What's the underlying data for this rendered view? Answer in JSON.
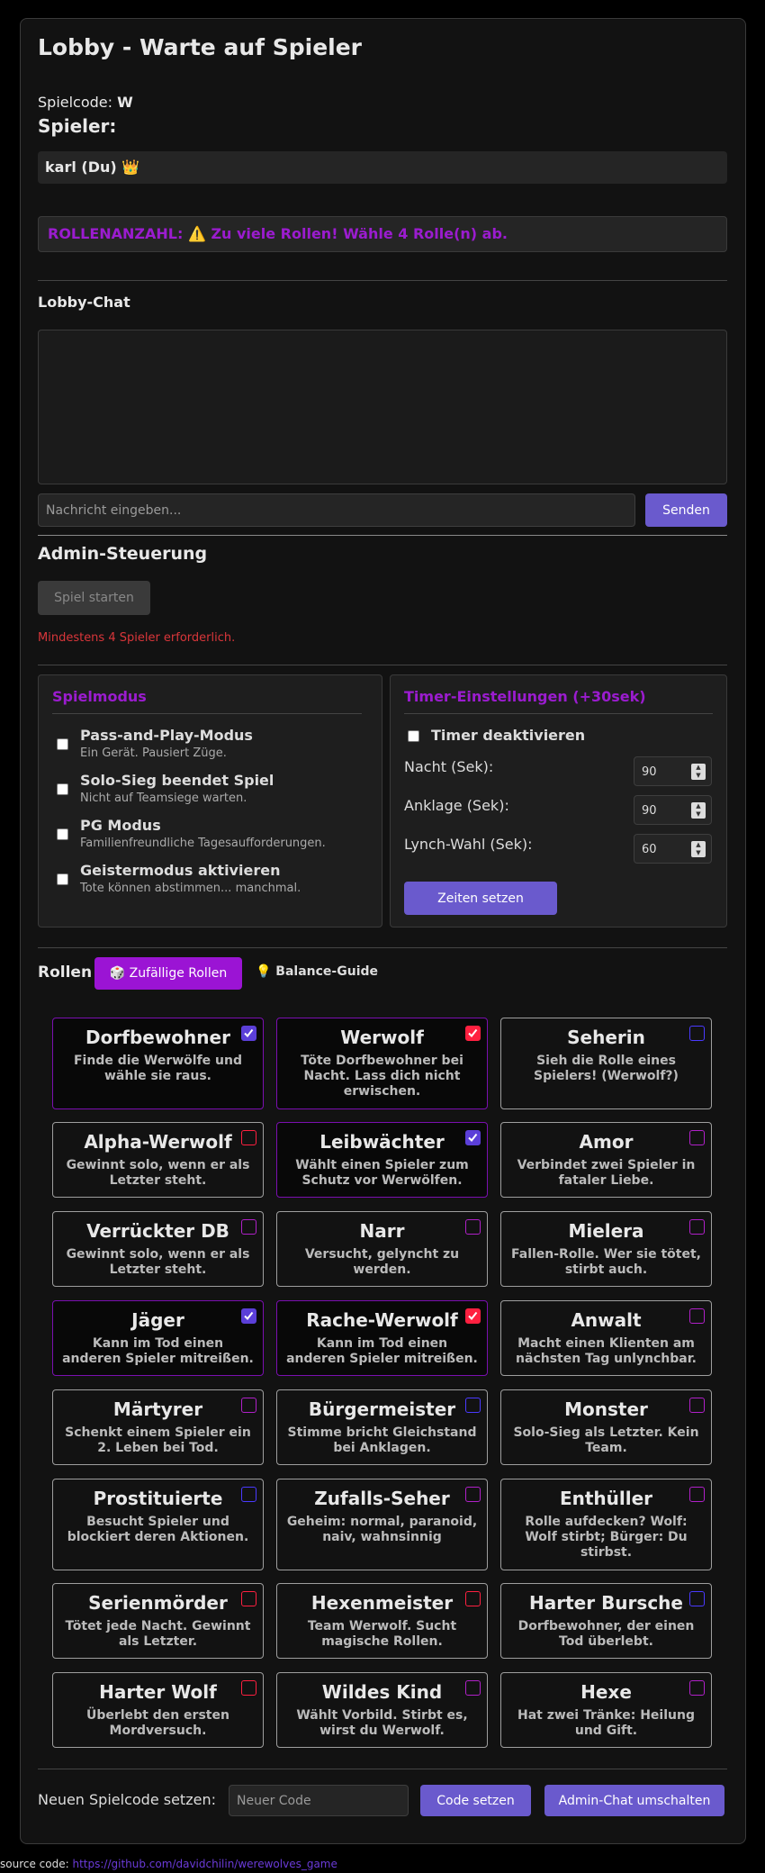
{
  "lobby": {
    "title": "Lobby - Warte auf Spieler",
    "code_label": "Spielcode:",
    "code_value": "W",
    "players_heading": "Spieler:",
    "players": [
      "karl (Du) 👑"
    ],
    "role_count_text": "ROLLENANZAHL: ⚠️ Zu viele Rollen! Wähle 4 Rolle(n) ab."
  },
  "chat": {
    "heading": "Lobby-Chat",
    "input_placeholder": "Nachricht eingeben...",
    "send_label": "Senden"
  },
  "admin": {
    "heading": "Admin-Steuerung",
    "start_label": "Spiel starten",
    "warning": "Mindestens 4 Spieler erforderlich."
  },
  "game_mode": {
    "title": "Spielmodus",
    "options": [
      {
        "title": "Pass-and-Play-Modus",
        "sub": "Ein Gerät. Pausiert Züge.",
        "checked": false
      },
      {
        "title": "Solo-Sieg beendet Spiel",
        "sub": "Nicht auf Teamsiege warten.",
        "checked": false
      },
      {
        "title": "PG Modus",
        "sub": "Familienfreundliche Tagesaufforderungen.",
        "checked": false
      },
      {
        "title": "Geistermodus aktivieren",
        "sub": "Tote können abstimmen... manchmal.",
        "checked": false
      }
    ]
  },
  "timer": {
    "title": "Timer-Einstellungen (+30sek)",
    "disable_label": "Timer deaktivieren",
    "rows": [
      {
        "label": "Nacht (Sek):",
        "value": "90"
      },
      {
        "label": "Anklage (Sek):",
        "value": "90"
      },
      {
        "label": "Lynch-Wahl (Sek):",
        "value": "60"
      }
    ],
    "set_label": "Zeiten setzen"
  },
  "roles": {
    "heading": "Rollen",
    "random_label": "🎲 Zufällige Rollen",
    "balance_label": "💡 Balance-Guide",
    "items": [
      {
        "name": "Dorfbewohner",
        "desc": "Finde die Werwölfe und wähle sie raus.",
        "selected": true,
        "team_color": "blue"
      },
      {
        "name": "Werwolf",
        "desc": "Töte Dorfbewohner bei Nacht. Lass dich nicht erwischen.",
        "selected": true,
        "team_color": "red"
      },
      {
        "name": "Seherin",
        "desc": "Sieh die Rolle eines Spielers! (Werwolf?)",
        "selected": false,
        "team_color": "blue"
      },
      {
        "name": "Alpha-Werwolf",
        "desc": "Gewinnt solo, wenn er als Letzter steht.",
        "selected": false,
        "team_color": "red"
      },
      {
        "name": "Leibwächter",
        "desc": "Wählt einen Spieler zum Schutz vor Werwölfen.",
        "selected": true,
        "team_color": "blue"
      },
      {
        "name": "Amor",
        "desc": "Verbindet zwei Spieler in fataler Liebe.",
        "selected": false,
        "team_color": "pur"
      },
      {
        "name": "Verrückter DB",
        "desc": "Gewinnt solo, wenn er als Letzter steht.",
        "selected": false,
        "team_color": "pur"
      },
      {
        "name": "Narr",
        "desc": "Versucht, gelyncht zu werden.",
        "selected": false,
        "team_color": "pur"
      },
      {
        "name": "Mielera",
        "desc": "Fallen-Rolle. Wer sie tötet, stirbt auch.",
        "selected": false,
        "team_color": "pur"
      },
      {
        "name": "Jäger",
        "desc": "Kann im Tod einen anderen Spieler mitreißen.",
        "selected": true,
        "team_color": "blue"
      },
      {
        "name": "Rache-Werwolf",
        "desc": "Kann im Tod einen anderen Spieler mitreißen.",
        "selected": true,
        "team_color": "red"
      },
      {
        "name": "Anwalt",
        "desc": "Macht einen Klienten am nächsten Tag unlynchbar.",
        "selected": false,
        "team_color": "pur"
      },
      {
        "name": "Märtyrer",
        "desc": "Schenkt einem Spieler ein 2. Leben bei Tod.",
        "selected": false,
        "team_color": "pur"
      },
      {
        "name": "Bürgermeister",
        "desc": "Stimme bricht Gleichstand bei Anklagen.",
        "selected": false,
        "team_color": "blue"
      },
      {
        "name": "Monster",
        "desc": "Solo-Sieg als Letzter. Kein Team.",
        "selected": false,
        "team_color": "pur"
      },
      {
        "name": "Prostituierte",
        "desc": "Besucht Spieler und blockiert deren Aktionen.",
        "selected": false,
        "team_color": "blue"
      },
      {
        "name": "Zufalls-Seher",
        "desc": "Geheim: normal, paranoid, naiv, wahnsinnig",
        "selected": false,
        "team_color": "pur"
      },
      {
        "name": "Enthüller",
        "desc": "Rolle aufdecken? Wolf: Wolf stirbt; Bürger: Du stirbst.",
        "selected": false,
        "team_color": "pur"
      },
      {
        "name": "Serienmörder",
        "desc": "Tötet jede Nacht. Gewinnt als Letzter.",
        "selected": false,
        "team_color": "red"
      },
      {
        "name": "Hexenmeister",
        "desc": "Team Werwolf. Sucht magische Rollen.",
        "selected": false,
        "team_color": "red"
      },
      {
        "name": "Harter Bursche",
        "desc": "Dorfbewohner, der einen Tod überlebt.",
        "selected": false,
        "team_color": "blue"
      },
      {
        "name": "Harter Wolf",
        "desc": "Überlebt den ersten Mordversuch.",
        "selected": false,
        "team_color": "red"
      },
      {
        "name": "Wildes Kind",
        "desc": "Wählt Vorbild. Stirbt es, wirst du Werwolf.",
        "selected": false,
        "team_color": "pur"
      },
      {
        "name": "Hexe",
        "desc": "Hat zwei Tränke: Heilung und Gift.",
        "selected": false,
        "team_color": "pur"
      }
    ]
  },
  "bottom": {
    "new_code_label": "Neuen Spielcode setzen:",
    "code_placeholder": "Neuer Code",
    "set_code_label": "Code setzen",
    "admin_chat_label": "Admin-Chat umschalten"
  },
  "source": {
    "label": "source code:",
    "link": "https://github.com/davidchilin/werewolves_game"
  },
  "colors": {
    "accent": "#6a5acd",
    "highlight": "#9b1ccf",
    "warning": "#d9363a"
  }
}
